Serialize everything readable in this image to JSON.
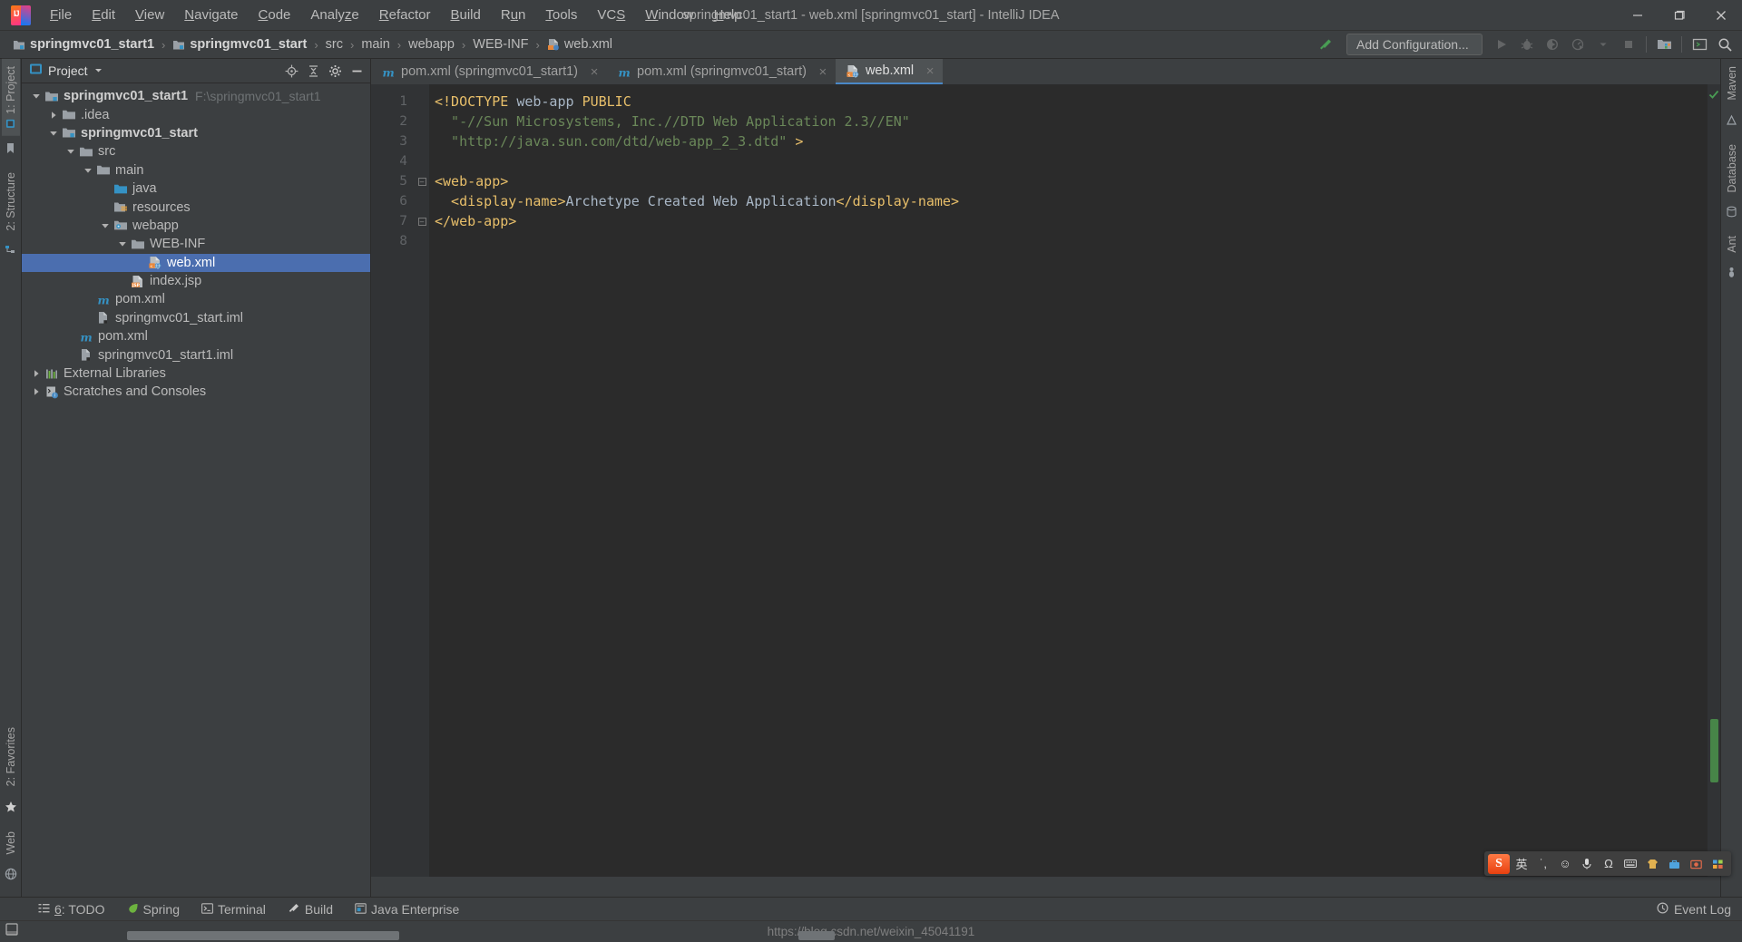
{
  "window": {
    "title": "springmvc01_start1 - web.xml [springmvc01_start] - IntelliJ IDEA",
    "minimize_label": "minimize-icon",
    "maximize_label": "restore-icon",
    "close_label": "close-icon"
  },
  "menubar": {
    "items": [
      {
        "label": "File",
        "mnemonic": "F"
      },
      {
        "label": "Edit",
        "mnemonic": "E"
      },
      {
        "label": "View",
        "mnemonic": "V"
      },
      {
        "label": "Navigate",
        "mnemonic": "N"
      },
      {
        "label": "Code",
        "mnemonic": "C"
      },
      {
        "label": "Analyze",
        "mnemonic": "z"
      },
      {
        "label": "Refactor",
        "mnemonic": "R"
      },
      {
        "label": "Build",
        "mnemonic": "B"
      },
      {
        "label": "Run",
        "mnemonic": "u"
      },
      {
        "label": "Tools",
        "mnemonic": "T"
      },
      {
        "label": "VCS",
        "mnemonic": "S"
      },
      {
        "label": "Window",
        "mnemonic": "W"
      },
      {
        "label": "Help",
        "mnemonic": "H"
      }
    ]
  },
  "breadcrumb": {
    "items": [
      {
        "label": "springmvc01_start1",
        "bold": true,
        "icon": "module-icon"
      },
      {
        "label": "springmvc01_start",
        "bold": true,
        "icon": "module-icon"
      },
      {
        "label": "src",
        "bold": false,
        "icon": ""
      },
      {
        "label": "main",
        "bold": false,
        "icon": ""
      },
      {
        "label": "webapp",
        "bold": false,
        "icon": ""
      },
      {
        "label": "WEB-INF",
        "bold": false,
        "icon": ""
      },
      {
        "label": "web.xml",
        "bold": false,
        "icon": "xml-file-icon"
      }
    ],
    "separator": "›"
  },
  "toolbar": {
    "build_hammer": "hammer-icon",
    "add_configuration_label": "Add Configuration...",
    "run_button": "run-icon",
    "debug_button": "debug-icon",
    "run_coverage_button": "run-with-coverage-icon",
    "profiler_button": "profiler-icon",
    "profiler_dropdown": "chevron-down-icon",
    "stop_button": "stop-icon",
    "project_structure_button": "project-structure-icon",
    "terminal_button": "terminal-icon",
    "search_button": "search-everywhere-icon"
  },
  "left_rail": {
    "tabs": [
      {
        "label": "1: Project",
        "active": true,
        "icon": "project-icon"
      },
      {
        "label": "2: Structure",
        "active": false,
        "icon": "structure-icon"
      },
      {
        "label": "2: Favorites",
        "active": false,
        "icon": "favorites-icon"
      },
      {
        "label": "Web",
        "active": false,
        "icon": "web-icon"
      }
    ]
  },
  "right_rail": {
    "tabs": [
      {
        "label": "Maven",
        "icon": "maven-icon"
      },
      {
        "label": "Database",
        "icon": "database-icon"
      },
      {
        "label": "Ant",
        "icon": "ant-icon"
      }
    ]
  },
  "project_panel": {
    "title": "Project",
    "icon": "project-view-icon",
    "caret": "chevron-down-icon",
    "actions": [
      {
        "name": "locate-icon",
        "title": "Select Opened File"
      },
      {
        "name": "collapse-all-icon",
        "title": "Collapse All"
      },
      {
        "name": "settings-icon",
        "title": "Settings"
      },
      {
        "name": "hide-icon",
        "title": "Hide"
      }
    ],
    "tree": [
      {
        "label": "springmvc01_start1",
        "path": "F:\\springmvc01_start1",
        "depth": 0,
        "arrow": "down",
        "icon": "module-icon",
        "bold": true,
        "selected": false
      },
      {
        "label": ".idea",
        "path": "",
        "depth": 1,
        "arrow": "right",
        "icon": "folder-icon",
        "bold": false,
        "selected": false
      },
      {
        "label": "springmvc01_start",
        "path": "",
        "depth": 1,
        "arrow": "down",
        "icon": "module-icon",
        "bold": true,
        "selected": false
      },
      {
        "label": "src",
        "path": "",
        "depth": 2,
        "arrow": "down",
        "icon": "folder-icon",
        "bold": false,
        "selected": false
      },
      {
        "label": "main",
        "path": "",
        "depth": 3,
        "arrow": "down",
        "icon": "folder-icon",
        "bold": false,
        "selected": false
      },
      {
        "label": "java",
        "path": "",
        "depth": 4,
        "arrow": "none",
        "icon": "source-folder-icon",
        "bold": false,
        "selected": false
      },
      {
        "label": "resources",
        "path": "",
        "depth": 4,
        "arrow": "none",
        "icon": "resource-folder-icon",
        "bold": false,
        "selected": false
      },
      {
        "label": "webapp",
        "path": "",
        "depth": 4,
        "arrow": "down",
        "icon": "web-folder-icon",
        "bold": false,
        "selected": false
      },
      {
        "label": "WEB-INF",
        "path": "",
        "depth": 5,
        "arrow": "down",
        "icon": "folder-icon",
        "bold": false,
        "selected": false
      },
      {
        "label": "web.xml",
        "path": "",
        "depth": 6,
        "arrow": "none",
        "icon": "web-xml-file-icon",
        "bold": false,
        "selected": true
      },
      {
        "label": "index.jsp",
        "path": "",
        "depth": 5,
        "arrow": "none",
        "icon": "jsp-file-icon",
        "bold": false,
        "selected": false
      },
      {
        "label": "pom.xml",
        "path": "",
        "depth": 3,
        "arrow": "none",
        "icon": "maven-pom-icon",
        "bold": false,
        "selected": false
      },
      {
        "label": "springmvc01_start.iml",
        "path": "",
        "depth": 3,
        "arrow": "none",
        "icon": "iml-file-icon",
        "bold": false,
        "selected": false
      },
      {
        "label": "pom.xml",
        "path": "",
        "depth": 2,
        "arrow": "none",
        "icon": "maven-pom-icon",
        "bold": false,
        "selected": false
      },
      {
        "label": "springmvc01_start1.iml",
        "path": "",
        "depth": 2,
        "arrow": "none",
        "icon": "iml-file-icon",
        "bold": false,
        "selected": false
      },
      {
        "label": "External Libraries",
        "path": "",
        "depth": 0,
        "arrow": "right",
        "icon": "libraries-icon",
        "bold": false,
        "selected": false
      },
      {
        "label": "Scratches and Consoles",
        "path": "",
        "depth": 0,
        "arrow": "right",
        "icon": "scratches-icon",
        "bold": false,
        "selected": false
      }
    ]
  },
  "editor": {
    "tabs": [
      {
        "label": "pom.xml (springmvc01_start1)",
        "icon": "maven-pom-icon",
        "active": false,
        "close": "×"
      },
      {
        "label": "pom.xml (springmvc01_start)",
        "icon": "maven-pom-icon",
        "active": false,
        "close": "×"
      },
      {
        "label": "web.xml",
        "icon": "web-xml-file-icon",
        "active": true,
        "close": "×"
      }
    ],
    "line_numbers": [
      "1",
      "2",
      "3",
      "4",
      "5",
      "6",
      "7",
      "8"
    ],
    "lines": [
      {
        "n": 1,
        "fold": false,
        "tokens": [
          {
            "t": "<!DOCTYPE ",
            "c": "tag"
          },
          {
            "t": "web-app ",
            "c": "txt"
          },
          {
            "t": "PUBLIC",
            "c": "tag"
          }
        ]
      },
      {
        "n": 2,
        "fold": false,
        "tokens": [
          {
            "t": "  \"-//Sun Microsystems, Inc.//DTD Web Application 2.3//EN\"",
            "c": "str"
          }
        ]
      },
      {
        "n": 3,
        "fold": false,
        "tokens": [
          {
            "t": "  \"http://java.sun.com/dtd/web-app_2_3.dtd\"",
            "c": "str"
          },
          {
            "t": " >",
            "c": "tag"
          }
        ]
      },
      {
        "n": 4,
        "fold": false,
        "tokens": [
          {
            "t": "",
            "c": "txt"
          }
        ]
      },
      {
        "n": 5,
        "fold": true,
        "tokens": [
          {
            "t": "<web-app>",
            "c": "tag"
          }
        ]
      },
      {
        "n": 6,
        "fold": false,
        "tokens": [
          {
            "t": "  <display-name>",
            "c": "tag"
          },
          {
            "t": "Archetype Created Web Application",
            "c": "txt"
          },
          {
            "t": "</display-name>",
            "c": "tag"
          }
        ]
      },
      {
        "n": 7,
        "fold": true,
        "tokens": [
          {
            "t": "</web-app>",
            "c": "tag"
          }
        ]
      },
      {
        "n": 8,
        "fold": false,
        "tokens": [
          {
            "t": "",
            "c": "txt"
          }
        ]
      }
    ],
    "inspection_status": "no-errors-check-icon"
  },
  "ime": {
    "logo_text": "S",
    "mode_label": "英",
    "buttons": [
      {
        "name": "ime-mode-english",
        "glyph": "英"
      },
      {
        "name": "ime-punctuation",
        "glyph": "˙,"
      },
      {
        "name": "ime-emoji",
        "glyph": "☺"
      },
      {
        "name": "ime-voice",
        "glyph": "ᴴ"
      },
      {
        "name": "ime-symbols",
        "glyph": "Ω"
      },
      {
        "name": "ime-keyboard",
        "glyph": "⌨"
      },
      {
        "name": "ime-skin",
        "glyph": "▤"
      },
      {
        "name": "ime-toolbox",
        "glyph": "▲"
      },
      {
        "name": "ime-screenshot",
        "glyph": "▣"
      },
      {
        "name": "ime-menu",
        "glyph": "▦"
      }
    ]
  },
  "tool_window_bar": {
    "items": [
      {
        "label": "6: TODO",
        "mnemonic": "6",
        "icon": "todo-icon"
      },
      {
        "label": "Spring",
        "mnemonic": "",
        "icon": "spring-icon"
      },
      {
        "label": "Terminal",
        "mnemonic": "",
        "icon": "terminal-icon"
      },
      {
        "label": "Build",
        "mnemonic": "",
        "icon": "build-icon"
      },
      {
        "label": "Java Enterprise",
        "mnemonic": "",
        "icon": "java-enterprise-icon"
      }
    ],
    "event_log": {
      "label": "Event Log",
      "icon": "event-log-icon"
    }
  },
  "status_bar": {
    "watermark": "https://blog.csdn.net/weixin_45041191",
    "layout_icon": "layout-icon"
  },
  "colors": {
    "accent_selection": "#4b6eaf",
    "editor_bg": "#2b2b2b",
    "panel_bg": "#3c3f41",
    "gutter_bg": "#313335",
    "tag": "#e8bf6a",
    "string": "#6a8759",
    "text": "#a9b7c6",
    "green_ok": "#499c54"
  }
}
